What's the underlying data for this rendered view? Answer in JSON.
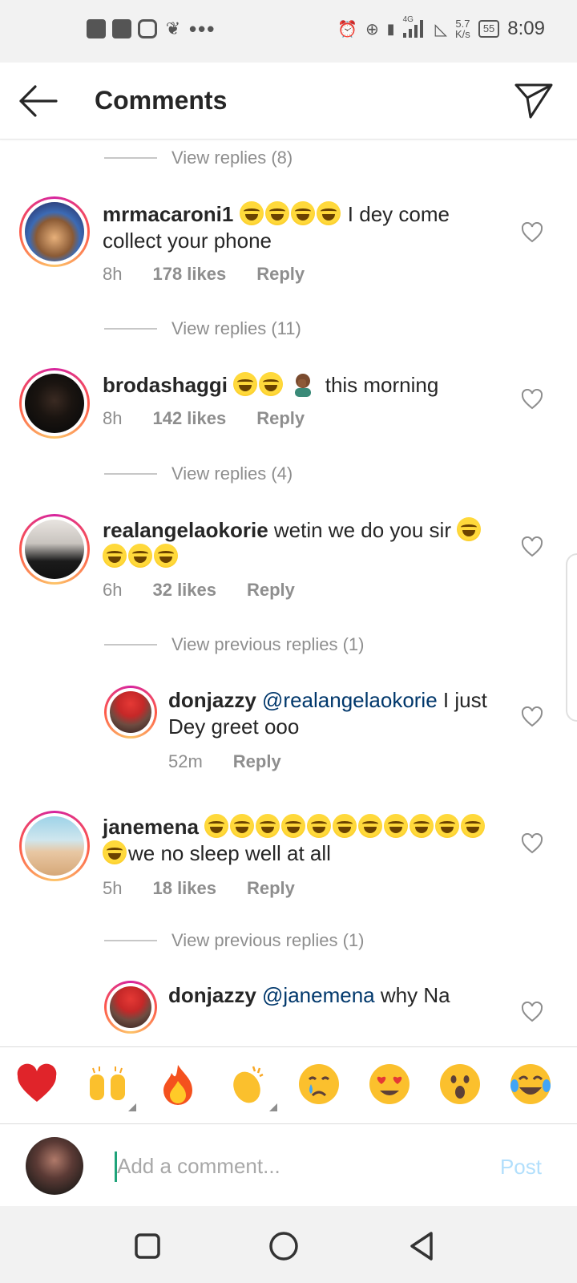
{
  "status_bar": {
    "time": "8:09",
    "network": "4G",
    "speed_value": "5.7",
    "speed_unit": "K/s",
    "battery": "55"
  },
  "header": {
    "title": "Comments"
  },
  "comments": [
    {
      "view_replies": "View replies (8)"
    },
    {
      "username": "mrmacaroni1",
      "text": "I dey come collect your phone",
      "time": "8h",
      "likes": "178 likes",
      "reply": "Reply",
      "view_replies": "View replies (11)"
    },
    {
      "username": "brodashaggi",
      "text": "this morning",
      "time": "8h",
      "likes": "142 likes",
      "reply": "Reply",
      "view_replies": "View replies (4)"
    },
    {
      "username": "realangelaokorie",
      "text": "wetin we do you sir",
      "time": "6h",
      "likes": "32 likes",
      "reply": "Reply",
      "view_replies": "View previous replies (1)"
    },
    {
      "username": "donjazzy",
      "mention": "@realangelaokorie",
      "text": "I just Dey greet ooo",
      "time": "52m",
      "reply": "Reply"
    },
    {
      "username": "janemena",
      "text": "we no sleep well at all",
      "time": "5h",
      "likes": "18 likes",
      "reply": "Reply",
      "view_replies": "View previous replies (1)"
    },
    {
      "username": "donjazzy",
      "mention": "@janemena",
      "text": "why Na"
    }
  ],
  "reactions": [
    "heart",
    "raised-hands",
    "fire",
    "clapping-hands",
    "crying-face",
    "heart-eyes",
    "surprised-face",
    "tears-of-joy"
  ],
  "composer": {
    "placeholder": "Add a comment...",
    "post_label": "Post"
  },
  "colors": {
    "link": "#00376b",
    "muted": "#8e8e8e",
    "post_disabled": "#b2dffc"
  }
}
